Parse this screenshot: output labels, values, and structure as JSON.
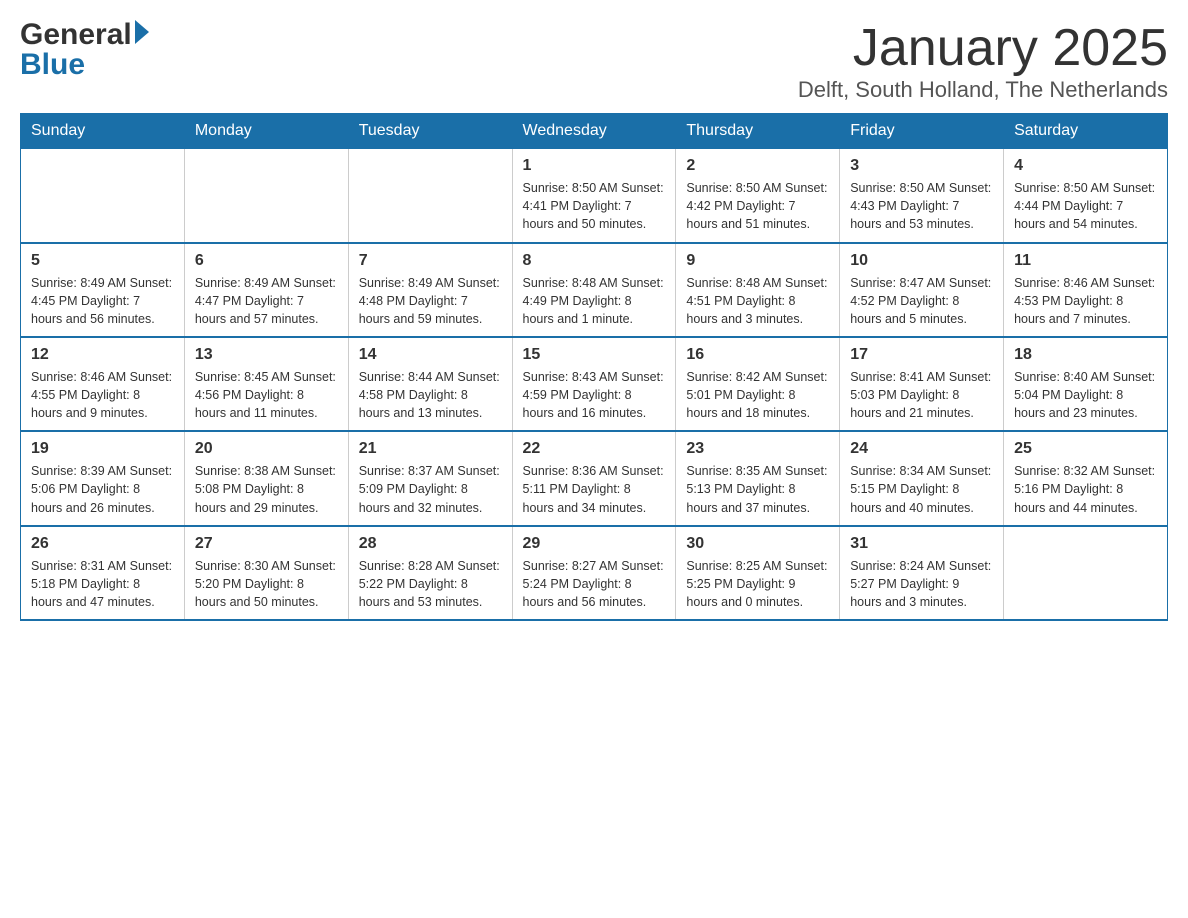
{
  "header": {
    "title": "January 2025",
    "subtitle": "Delft, South Holland, The Netherlands"
  },
  "logo": {
    "part1": "General",
    "part2": "Blue"
  },
  "days_of_week": [
    "Sunday",
    "Monday",
    "Tuesday",
    "Wednesday",
    "Thursday",
    "Friday",
    "Saturday"
  ],
  "weeks": [
    [
      {
        "day": "",
        "info": ""
      },
      {
        "day": "",
        "info": ""
      },
      {
        "day": "",
        "info": ""
      },
      {
        "day": "1",
        "info": "Sunrise: 8:50 AM\nSunset: 4:41 PM\nDaylight: 7 hours\nand 50 minutes."
      },
      {
        "day": "2",
        "info": "Sunrise: 8:50 AM\nSunset: 4:42 PM\nDaylight: 7 hours\nand 51 minutes."
      },
      {
        "day": "3",
        "info": "Sunrise: 8:50 AM\nSunset: 4:43 PM\nDaylight: 7 hours\nand 53 minutes."
      },
      {
        "day": "4",
        "info": "Sunrise: 8:50 AM\nSunset: 4:44 PM\nDaylight: 7 hours\nand 54 minutes."
      }
    ],
    [
      {
        "day": "5",
        "info": "Sunrise: 8:49 AM\nSunset: 4:45 PM\nDaylight: 7 hours\nand 56 minutes."
      },
      {
        "day": "6",
        "info": "Sunrise: 8:49 AM\nSunset: 4:47 PM\nDaylight: 7 hours\nand 57 minutes."
      },
      {
        "day": "7",
        "info": "Sunrise: 8:49 AM\nSunset: 4:48 PM\nDaylight: 7 hours\nand 59 minutes."
      },
      {
        "day": "8",
        "info": "Sunrise: 8:48 AM\nSunset: 4:49 PM\nDaylight: 8 hours\nand 1 minute."
      },
      {
        "day": "9",
        "info": "Sunrise: 8:48 AM\nSunset: 4:51 PM\nDaylight: 8 hours\nand 3 minutes."
      },
      {
        "day": "10",
        "info": "Sunrise: 8:47 AM\nSunset: 4:52 PM\nDaylight: 8 hours\nand 5 minutes."
      },
      {
        "day": "11",
        "info": "Sunrise: 8:46 AM\nSunset: 4:53 PM\nDaylight: 8 hours\nand 7 minutes."
      }
    ],
    [
      {
        "day": "12",
        "info": "Sunrise: 8:46 AM\nSunset: 4:55 PM\nDaylight: 8 hours\nand 9 minutes."
      },
      {
        "day": "13",
        "info": "Sunrise: 8:45 AM\nSunset: 4:56 PM\nDaylight: 8 hours\nand 11 minutes."
      },
      {
        "day": "14",
        "info": "Sunrise: 8:44 AM\nSunset: 4:58 PM\nDaylight: 8 hours\nand 13 minutes."
      },
      {
        "day": "15",
        "info": "Sunrise: 8:43 AM\nSunset: 4:59 PM\nDaylight: 8 hours\nand 16 minutes."
      },
      {
        "day": "16",
        "info": "Sunrise: 8:42 AM\nSunset: 5:01 PM\nDaylight: 8 hours\nand 18 minutes."
      },
      {
        "day": "17",
        "info": "Sunrise: 8:41 AM\nSunset: 5:03 PM\nDaylight: 8 hours\nand 21 minutes."
      },
      {
        "day": "18",
        "info": "Sunrise: 8:40 AM\nSunset: 5:04 PM\nDaylight: 8 hours\nand 23 minutes."
      }
    ],
    [
      {
        "day": "19",
        "info": "Sunrise: 8:39 AM\nSunset: 5:06 PM\nDaylight: 8 hours\nand 26 minutes."
      },
      {
        "day": "20",
        "info": "Sunrise: 8:38 AM\nSunset: 5:08 PM\nDaylight: 8 hours\nand 29 minutes."
      },
      {
        "day": "21",
        "info": "Sunrise: 8:37 AM\nSunset: 5:09 PM\nDaylight: 8 hours\nand 32 minutes."
      },
      {
        "day": "22",
        "info": "Sunrise: 8:36 AM\nSunset: 5:11 PM\nDaylight: 8 hours\nand 34 minutes."
      },
      {
        "day": "23",
        "info": "Sunrise: 8:35 AM\nSunset: 5:13 PM\nDaylight: 8 hours\nand 37 minutes."
      },
      {
        "day": "24",
        "info": "Sunrise: 8:34 AM\nSunset: 5:15 PM\nDaylight: 8 hours\nand 40 minutes."
      },
      {
        "day": "25",
        "info": "Sunrise: 8:32 AM\nSunset: 5:16 PM\nDaylight: 8 hours\nand 44 minutes."
      }
    ],
    [
      {
        "day": "26",
        "info": "Sunrise: 8:31 AM\nSunset: 5:18 PM\nDaylight: 8 hours\nand 47 minutes."
      },
      {
        "day": "27",
        "info": "Sunrise: 8:30 AM\nSunset: 5:20 PM\nDaylight: 8 hours\nand 50 minutes."
      },
      {
        "day": "28",
        "info": "Sunrise: 8:28 AM\nSunset: 5:22 PM\nDaylight: 8 hours\nand 53 minutes."
      },
      {
        "day": "29",
        "info": "Sunrise: 8:27 AM\nSunset: 5:24 PM\nDaylight: 8 hours\nand 56 minutes."
      },
      {
        "day": "30",
        "info": "Sunrise: 8:25 AM\nSunset: 5:25 PM\nDaylight: 9 hours\nand 0 minutes."
      },
      {
        "day": "31",
        "info": "Sunrise: 8:24 AM\nSunset: 5:27 PM\nDaylight: 9 hours\nand 3 minutes."
      },
      {
        "day": "",
        "info": ""
      }
    ]
  ]
}
